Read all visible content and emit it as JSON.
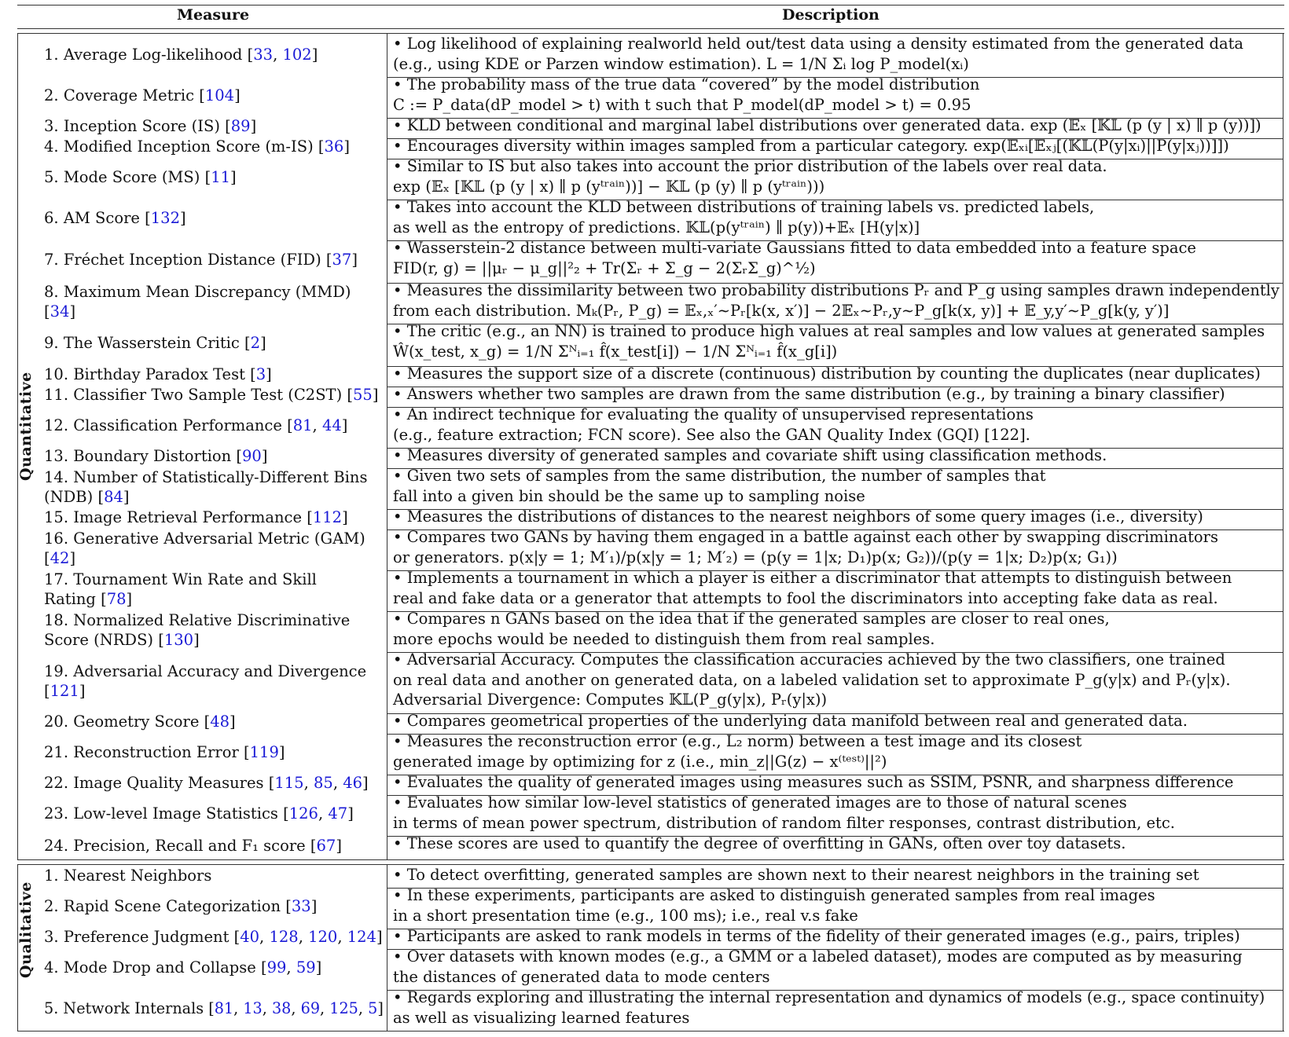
{
  "header": {
    "measure": "Measure",
    "description": "Description"
  },
  "sections": {
    "quantitative": "Quantitative",
    "qualitative": "Qualitative"
  },
  "quantitative": [
    {
      "num": "1.",
      "name": "Average Log-likelihood",
      "refs": [
        "33",
        "102"
      ],
      "desc": [
        "• Log likelihood of explaining realworld held out/test data using a density estimated from the generated data",
        "(e.g., using KDE or Parzen window estimation).  L = 1/N Σᵢ log P_model(xᵢ)"
      ]
    },
    {
      "num": "2.",
      "name": "Coverage Metric",
      "refs": [
        "104"
      ],
      "desc": [
        "• The probability mass of the true data “covered” by the model distribution",
        "C := P_data(dP_model > t) with t such that P_model(dP_model > t) = 0.95"
      ]
    },
    {
      "num": "3.",
      "name": "Inception Score (IS)",
      "refs": [
        "89"
      ],
      "desc": [
        "• KLD between conditional and marginal label distributions over generated data.  exp (𝔼ₓ [𝕂𝕃 (p (y | x) ∥ p (y))])"
      ]
    },
    {
      "num": "4.",
      "name": "Modified Inception Score (m-IS)",
      "refs": [
        "36"
      ],
      "desc": [
        "• Encourages diversity within images sampled from a particular category.  exp(𝔼ₓᵢ[𝔼ₓⱼ[(𝕂𝕃(P(y|xᵢ)||P(y|xⱼ))]])"
      ]
    },
    {
      "num": "5.",
      "name": "Mode Score (MS)",
      "refs": [
        "11"
      ],
      "desc": [
        "• Similar to IS but also takes into account the prior distribution of the labels over real data.",
        "exp (𝔼ₓ [𝕂𝕃 (p (y | x) ∥ p (yᵗʳᵃⁱⁿ))] − 𝕂𝕃 (p (y) ∥ p (yᵗʳᵃⁱⁿ)))"
      ]
    },
    {
      "num": "6.",
      "name": "AM Score",
      "refs": [
        "132"
      ],
      "desc": [
        "• Takes into account the KLD between distributions of training labels vs. predicted labels,",
        "as well as the entropy of predictions.  𝕂𝕃(p(yᵗʳᵃⁱⁿ) ∥ p(y))+𝔼ₓ [H(y|x)]"
      ]
    },
    {
      "num": "7.",
      "name": "Fréchet Inception Distance (FID)",
      "refs": [
        "37"
      ],
      "desc": [
        "• Wasserstein-2 distance between multi-variate Gaussians fitted to data embedded into a feature space",
        "FID(r, g) = ||μᵣ − μ_g||²₂ + Tr(Σᵣ + Σ_g − 2(ΣᵣΣ_g)^½)"
      ]
    },
    {
      "num": "8.",
      "name": "Maximum Mean Discrepancy (MMD)",
      "name2": "",
      "refs": [
        "34"
      ],
      "desc": [
        "• Measures the dissimilarity between two probability distributions Pᵣ and P_g using samples drawn independently",
        "from each distribution.  Mₖ(Pᵣ, P_g) = 𝔼ₓ,ₓ′∼Pᵣ[k(x, x′)] − 2𝔼ₓ∼Pᵣ,y∼P_g[k(x, y)] + 𝔼_y,y′∼P_g[k(y, y′)]"
      ]
    },
    {
      "num": "9.",
      "name": "The Wasserstein Critic",
      "refs": [
        "2"
      ],
      "desc": [
        "• The critic (e.g., an NN) is trained to produce high values at real samples and low values at generated samples",
        "Ŵ(x_test, x_g) = 1/N Σᴺᵢ₌₁ f̂(x_test[i]) − 1/N Σᴺᵢ₌₁ f̂(x_g[i])"
      ]
    },
    {
      "num": "10.",
      "name": "Birthday Paradox Test",
      "refs": [
        "3"
      ],
      "desc": [
        "• Measures the support size of a discrete (continuous) distribution by counting the duplicates (near duplicates)"
      ]
    },
    {
      "num": "11.",
      "name": "Classifier Two Sample Test (C2ST)",
      "refs": [
        "55"
      ],
      "desc": [
        "• Answers whether two samples are drawn from the same distribution (e.g., by training a binary classifier)"
      ]
    },
    {
      "num": "12.",
      "name": "Classification Performance",
      "refs": [
        "81",
        "44"
      ],
      "desc": [
        "• An indirect technique for evaluating the quality of unsupervised representations",
        "(e.g., feature extraction; FCN score). See also the GAN Quality Index (GQI) [122]."
      ]
    },
    {
      "num": "13.",
      "name": "Boundary Distortion",
      "refs": [
        "90"
      ],
      "desc": [
        "• Measures diversity of generated samples and covariate shift using classification methods."
      ]
    },
    {
      "num": "14.",
      "name": "Number of Statistically-Different Bins",
      "name2": "(NDB)",
      "refs": [
        "84"
      ],
      "desc": [
        "• Given two sets of samples from the same distribution, the number of samples that",
        "fall into a given bin should be the same up to sampling noise"
      ]
    },
    {
      "num": "15.",
      "name": "Image Retrieval Performance",
      "refs": [
        "112"
      ],
      "desc": [
        "• Measures the distributions of distances to the nearest neighbors of some query images (i.e., diversity)"
      ]
    },
    {
      "num": "16.",
      "name": "Generative Adversarial Metric (GAM)",
      "name2": "",
      "refs": [
        "42"
      ],
      "desc": [
        "• Compares two GANs by having them engaged in a battle against each other by swapping discriminators",
        "or generators.  p(x|y = 1; M′₁)/p(x|y = 1; M′₂) = (p(y = 1|x; D₁)p(x; G₂))/(p(y = 1|x; D₂)p(x; G₁))"
      ]
    },
    {
      "num": "17.",
      "name": "Tournament Win Rate and Skill",
      "name2": "Rating",
      "refs": [
        "78"
      ],
      "desc": [
        "• Implements a tournament in which a player is either a discriminator that attempts to distinguish between",
        "real and fake data or a generator that attempts to fool the discriminators into accepting fake data as real."
      ]
    },
    {
      "num": "18.",
      "name": "Normalized Relative Discriminative",
      "name2": "Score (NRDS)",
      "refs": [
        "130"
      ],
      "desc": [
        "• Compares n GANs based on the idea that if the generated samples are closer to real ones,",
        "more epochs would be needed to distinguish them from real samples."
      ]
    },
    {
      "num": "19.",
      "name": "Adversarial Accuracy and Divergence",
      "name2": "",
      "refs": [
        "121"
      ],
      "desc": [
        "• Adversarial Accuracy. Computes the classification accuracies achieved by the two classifiers, one trained",
        "on real data and another on generated data, on a labeled validation set to approximate P_g(y|x) and Pᵣ(y|x).",
        "Adversarial Divergence: Computes 𝕂𝕃(P_g(y|x), Pᵣ(y|x))"
      ]
    },
    {
      "num": "20.",
      "name": "Geometry Score",
      "refs": [
        "48"
      ],
      "desc": [
        "• Compares geometrical properties of the underlying data manifold between real and generated data."
      ]
    },
    {
      "num": "21.",
      "name": "Reconstruction Error",
      "refs": [
        "119"
      ],
      "desc": [
        "• Measures the reconstruction error (e.g., L₂ norm) between a test image and its closest",
        "generated image by optimizing for z (i.e., min_z||G(z) − x⁽ᵗᵉˢᵗ⁾||²)"
      ]
    },
    {
      "num": "22.",
      "name": "Image Quality Measures",
      "refs": [
        "115",
        "85",
        "46"
      ],
      "desc": [
        "• Evaluates the quality of generated images using measures such as SSIM, PSNR, and sharpness difference"
      ]
    },
    {
      "num": "23.",
      "name": "Low-level Image Statistics",
      "refs": [
        "126",
        "47"
      ],
      "desc": [
        "• Evaluates how similar low-level statistics of generated images are to those of natural scenes",
        "in terms of mean power spectrum, distribution of random filter responses, contrast distribution, etc."
      ]
    },
    {
      "num": "24.",
      "name": "Precision, Recall and F₁ score",
      "refs": [
        "67"
      ],
      "desc": [
        "• These scores are used to quantify the degree of overfitting in GANs, often over toy datasets."
      ]
    }
  ],
  "qualitative": [
    {
      "num": "1.",
      "name": "Nearest Neighbors",
      "refs": [],
      "desc": [
        "• To detect overfitting, generated samples are shown next to their nearest neighbors in the training set"
      ]
    },
    {
      "num": "2.",
      "name": "Rapid Scene Categorization",
      "refs": [
        "33"
      ],
      "desc": [
        "• In these experiments, participants are asked to distinguish generated samples from real images",
        "in a short presentation time (e.g., 100 ms); i.e., real v.s fake"
      ]
    },
    {
      "num": "3.",
      "name": "Preference Judgment",
      "refs": [
        "40",
        "128",
        "120",
        "124"
      ],
      "desc": [
        "• Participants are asked to rank models in terms of the fidelity of their generated images (e.g., pairs, triples)"
      ]
    },
    {
      "num": "4.",
      "name": "Mode Drop and Collapse",
      "refs": [
        "99",
        "59"
      ],
      "desc": [
        "• Over datasets with known modes (e.g., a GMM or a labeled dataset), modes are computed as by measuring",
        "the distances of generated data to mode centers"
      ]
    },
    {
      "num": "5.",
      "name": "Network Internals",
      "refs": [
        "81",
        "13",
        "38",
        "69",
        "125",
        "5"
      ],
      "desc": [
        "• Regards exploring and illustrating the internal representation and dynamics of models (e.g., space continuity)",
        "as well as visualizing learned features"
      ]
    }
  ]
}
